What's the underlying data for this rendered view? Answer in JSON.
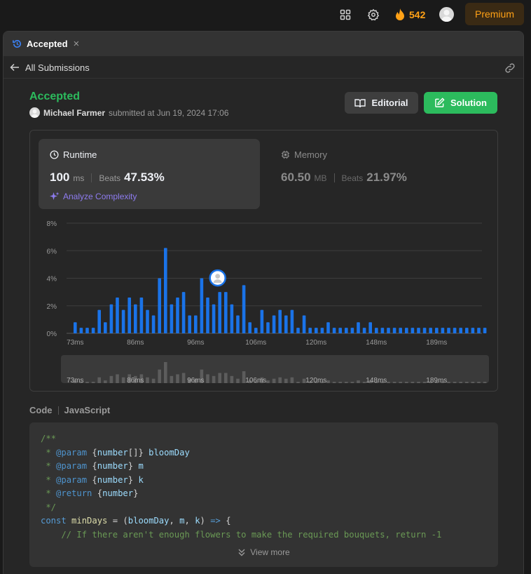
{
  "topbar": {
    "streak_count": "542",
    "premium_label": "Premium",
    "icons": [
      "layout-grid-icon",
      "gear-icon",
      "fire-icon",
      "avatar"
    ]
  },
  "tab": {
    "label": "Accepted"
  },
  "subbar": {
    "label": "All Submissions"
  },
  "submission": {
    "status": "Accepted",
    "author": "Michael Farmer",
    "submitted_text": "submitted at Jun 19, 2024 17:06"
  },
  "buttons": {
    "editorial": "Editorial",
    "solution": "Solution"
  },
  "runtime": {
    "title": "Runtime",
    "value": "100",
    "unit": "ms",
    "beats_label": "Beats",
    "beats_pct": "47.53%",
    "analyze_label": "Analyze Complexity"
  },
  "memory": {
    "title": "Memory",
    "value": "60.50",
    "unit": "MB",
    "beats_label": "Beats",
    "beats_pct": "21.97%"
  },
  "colors": {
    "accent_green": "#2cbb5d",
    "bar_blue": "#1a73e8",
    "premium_orange": "#ffa116",
    "analyze_purple": "#8e7cf0"
  },
  "chart_data": {
    "type": "bar",
    "y_tick_labels": [
      "8%",
      "6%",
      "4%",
      "2%",
      "0%"
    ],
    "ylim": [
      0,
      8
    ],
    "x_tick_labels": [
      "73ms",
      "86ms",
      "96ms",
      "106ms",
      "120ms",
      "148ms",
      "189ms"
    ],
    "x_tick_bar_index": [
      0,
      10,
      20,
      30,
      40,
      50,
      60
    ],
    "values": [
      0.8,
      0.4,
      0.4,
      0.4,
      1.7,
      0.8,
      2.1,
      2.6,
      1.7,
      2.6,
      2.1,
      2.6,
      1.7,
      1.3,
      4.0,
      6.2,
      2.1,
      2.6,
      3.0,
      1.3,
      1.3,
      4.0,
      2.6,
      2.1,
      3.0,
      3.0,
      2.1,
      1.3,
      3.5,
      0.8,
      0.4,
      1.7,
      0.8,
      1.3,
      1.7,
      1.3,
      1.7,
      0.4,
      1.3,
      0.4,
      0.4,
      0.4,
      0.8,
      0.4,
      0.4,
      0.4,
      0.4,
      0.8,
      0.4,
      0.8,
      0.4,
      0.4,
      0.4,
      0.4,
      0.4,
      0.4,
      0.4,
      0.4,
      0.4,
      0.4,
      0.4,
      0.4,
      0.4,
      0.4,
      0.4,
      0.4,
      0.4,
      0.4,
      0.4
    ],
    "highlight_index": 24,
    "grid": true
  },
  "code": {
    "label": "Code",
    "language": "JavaScript",
    "view_more": "View more",
    "lines": [
      [
        {
          "t": "/**",
          "c": "c-comment"
        }
      ],
      [
        {
          "t": " * ",
          "c": "c-comment"
        },
        {
          "t": "@param",
          "c": "c-tag"
        },
        {
          "t": " {",
          "c": "c-plain"
        },
        {
          "t": "number",
          "c": "c-type"
        },
        {
          "t": "[]} ",
          "c": "c-plain"
        },
        {
          "t": "bloomDay",
          "c": "c-ident"
        }
      ],
      [
        {
          "t": " * ",
          "c": "c-comment"
        },
        {
          "t": "@param",
          "c": "c-tag"
        },
        {
          "t": " {",
          "c": "c-plain"
        },
        {
          "t": "number",
          "c": "c-type"
        },
        {
          "t": "} ",
          "c": "c-plain"
        },
        {
          "t": "m",
          "c": "c-ident"
        }
      ],
      [
        {
          "t": " * ",
          "c": "c-comment"
        },
        {
          "t": "@param",
          "c": "c-tag"
        },
        {
          "t": " {",
          "c": "c-plain"
        },
        {
          "t": "number",
          "c": "c-type"
        },
        {
          "t": "} ",
          "c": "c-plain"
        },
        {
          "t": "k",
          "c": "c-ident"
        }
      ],
      [
        {
          "t": " * ",
          "c": "c-comment"
        },
        {
          "t": "@return",
          "c": "c-tag"
        },
        {
          "t": " {",
          "c": "c-plain"
        },
        {
          "t": "number",
          "c": "c-type"
        },
        {
          "t": "}",
          "c": "c-plain"
        }
      ],
      [
        {
          "t": " */",
          "c": "c-comment"
        }
      ],
      [
        {
          "t": "const ",
          "c": "c-kw"
        },
        {
          "t": "minDays",
          "c": "c-fn"
        },
        {
          "t": " = (",
          "c": "c-plain"
        },
        {
          "t": "bloomDay",
          "c": "c-ident"
        },
        {
          "t": ", ",
          "c": "c-plain"
        },
        {
          "t": "m",
          "c": "c-ident"
        },
        {
          "t": ", ",
          "c": "c-plain"
        },
        {
          "t": "k",
          "c": "c-ident"
        },
        {
          "t": ") ",
          "c": "c-plain"
        },
        {
          "t": "=>",
          "c": "c-kw"
        },
        {
          "t": " {",
          "c": "c-plain"
        }
      ],
      [
        {
          "t": "    // If there aren't enough flowers to make the required bouquets, return -1",
          "c": "c-comment"
        }
      ]
    ]
  }
}
